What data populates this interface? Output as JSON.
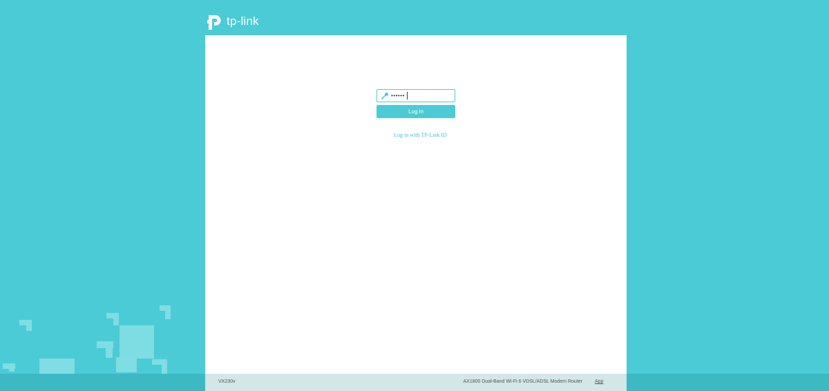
{
  "brand": {
    "logo_text": "tp-link"
  },
  "login": {
    "password_value": "••••••",
    "password_mask": "••••••",
    "button_label": "Log in",
    "tplink_id_link": "Log in with TP-Link ID"
  },
  "footer": {
    "model": "VX230v",
    "description": "AX1800 Dual-Band Wi-Fi 6 VDSL/ADSL Modem Router",
    "app_link": "App"
  },
  "colors": {
    "background": "#4bcbd6",
    "accent": "#4bcbd6",
    "footer_band": "#3db9c4",
    "footer_inner": "#d3e6e8"
  },
  "icons": {
    "logo": "tp-link-logo-icon",
    "password": "key-icon"
  }
}
